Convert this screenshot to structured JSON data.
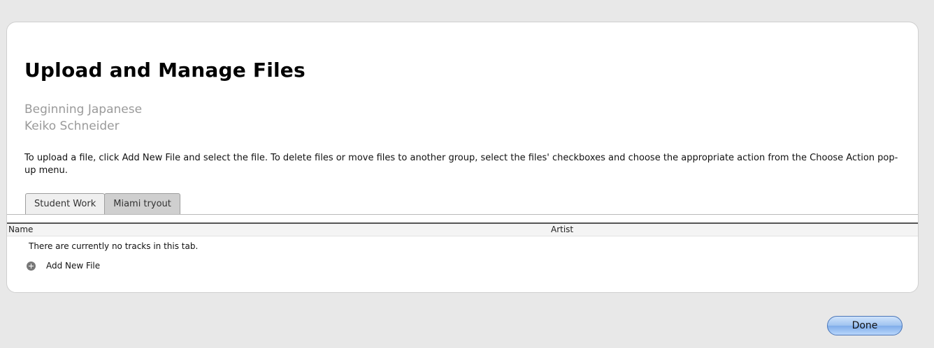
{
  "page": {
    "title": "Upload and Manage Files",
    "course": "Beginning Japanese",
    "teacher": "Keiko Schneider",
    "instructions": "To upload a file, click Add New File and select the file. To delete files or move files to another group, select the files' checkboxes and choose the appropriate action from the Choose Action pop-up menu."
  },
  "tabs": [
    {
      "label": "Student Work",
      "active": true
    },
    {
      "label": "Miami tryout",
      "active": false
    }
  ],
  "table": {
    "columns": [
      "Name",
      "Artist"
    ],
    "empty_message": "There are currently no tracks in this tab."
  },
  "actions": {
    "add_new_file": "Add New File",
    "add_icon": "add-circle-icon",
    "done": "Done"
  },
  "colors": {
    "background": "#e8e8e8",
    "subtitle": "#9a9a9a",
    "done_button": "#9fc3f0"
  }
}
